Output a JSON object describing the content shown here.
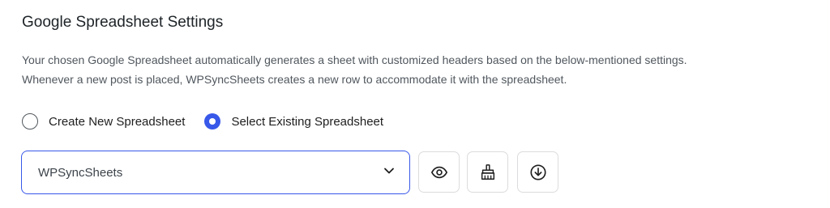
{
  "section": {
    "title": "Google Spreadsheet Settings",
    "description_line1": "Your chosen Google Spreadsheet automatically generates a sheet with customized headers based on the below-mentioned settings.",
    "description_line2": "Whenever a new post is placed, WPSyncSheets creates a new row to accommodate it with the spreadsheet."
  },
  "spreadsheet_mode": {
    "options": [
      {
        "label": "Create New Spreadsheet",
        "selected": false
      },
      {
        "label": "Select Existing Spreadsheet",
        "selected": true
      }
    ]
  },
  "spreadsheet_select": {
    "selected_value": "WPSyncSheets",
    "icon": "chevron-down-icon"
  },
  "actions": [
    {
      "icon": "eye-icon"
    },
    {
      "icon": "broom-icon"
    },
    {
      "icon": "download-icon"
    }
  ],
  "colors": {
    "accent": "#3858e9",
    "text": "#1d2327",
    "muted": "#50575e",
    "border": "#dcdcde"
  }
}
